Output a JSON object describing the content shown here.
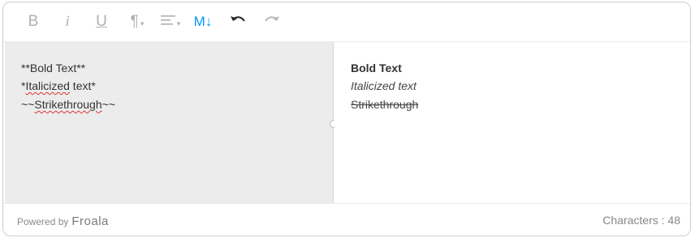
{
  "toolbar": {
    "bold_glyph": "B",
    "italic_glyph": "i",
    "underline_glyph": "U",
    "paragraph_glyph": "¶",
    "markdown_glyph": "M↓",
    "caret_glyph": "▾",
    "icons": [
      "bold-icon",
      "italic-icon",
      "underline-icon",
      "paragraph-format-icon",
      "align-icon",
      "markdown-icon",
      "undo-icon",
      "redo-icon"
    ],
    "active_color": "#0098f7"
  },
  "editor": {
    "markdown_lines": [
      "**Bold Text**",
      "*",
      "Italicized",
      " text*",
      "~~",
      "Strikethrough",
      "~~"
    ],
    "preview": {
      "bold": "Bold Text",
      "italic": "Italicized text",
      "strike": "Strikethrough"
    }
  },
  "footer": {
    "powered_by": "Powered by",
    "brand": "Froala",
    "characters": "Characters : 48"
  }
}
